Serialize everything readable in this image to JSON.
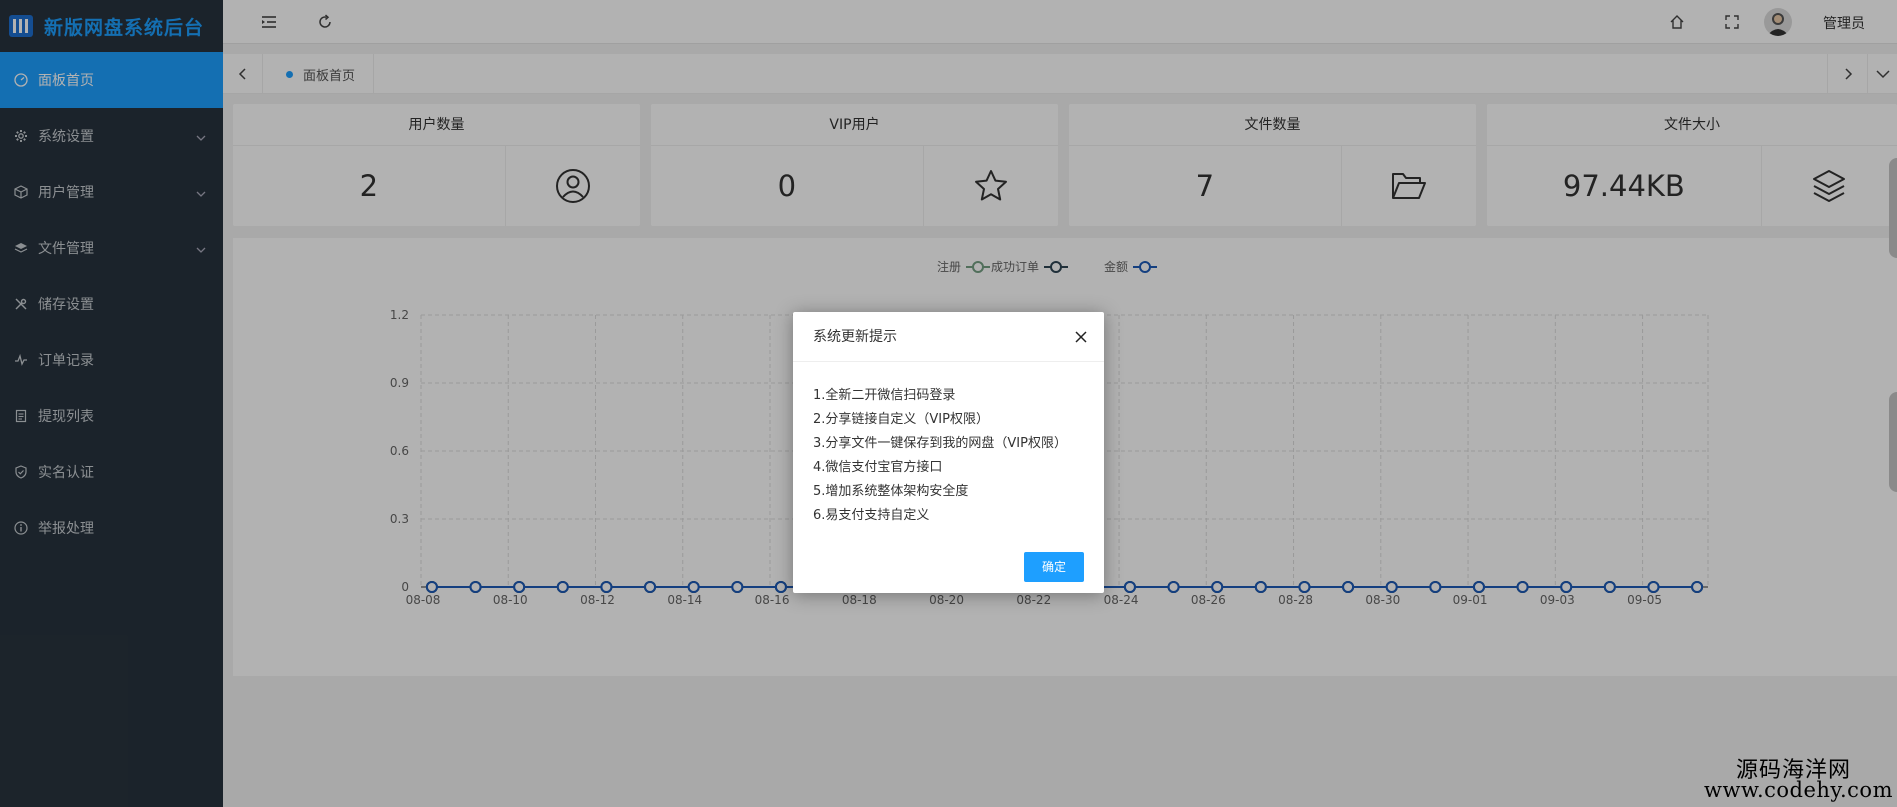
{
  "app": {
    "logo_text": "新版网盘系统后台"
  },
  "sidebar": {
    "items": [
      {
        "label": "面板首页",
        "icon": "dashboard-icon",
        "active": true,
        "has_arrow": false
      },
      {
        "label": "系统设置",
        "icon": "gear-icon",
        "active": false,
        "has_arrow": true
      },
      {
        "label": "用户管理",
        "icon": "cube-icon",
        "active": false,
        "has_arrow": true
      },
      {
        "label": "文件管理",
        "icon": "layers-icon",
        "active": false,
        "has_arrow": true
      },
      {
        "label": "储存设置",
        "icon": "tools-icon",
        "active": false,
        "has_arrow": false
      },
      {
        "label": "订单记录",
        "icon": "pulse-icon",
        "active": false,
        "has_arrow": false
      },
      {
        "label": "提现列表",
        "icon": "list-icon",
        "active": false,
        "has_arrow": false
      },
      {
        "label": "实名认证",
        "icon": "shield-icon",
        "active": false,
        "has_arrow": false
      },
      {
        "label": "举报处理",
        "icon": "info-icon",
        "active": false,
        "has_arrow": false
      }
    ]
  },
  "header": {
    "user_name": "管理员"
  },
  "tabs": {
    "current": "面板首页"
  },
  "stats": [
    {
      "title": "用户数量",
      "value": "2",
      "icon": "user-circle-icon"
    },
    {
      "title": "VIP用户",
      "value": "0",
      "icon": "star-icon"
    },
    {
      "title": "文件数量",
      "value": "7",
      "icon": "folder-open-icon"
    },
    {
      "title": "文件大小",
      "value": "97.44KB",
      "icon": "stack-icon"
    }
  ],
  "chart_data": {
    "type": "line",
    "legend": [
      "注册",
      "成功订单",
      "金额"
    ],
    "legend_placement": "top-center",
    "x": [
      "08-08",
      "08-09",
      "08-10",
      "08-11",
      "08-12",
      "08-13",
      "08-14",
      "08-15",
      "08-16",
      "08-17",
      "08-18",
      "08-19",
      "08-20",
      "08-21",
      "08-22",
      "08-23",
      "08-24",
      "08-25",
      "08-26",
      "08-27",
      "08-28",
      "08-29",
      "08-30",
      "08-31",
      "09-01",
      "09-02",
      "09-03",
      "09-04",
      "09-05",
      "09-06"
    ],
    "x_tick_labels": [
      "08-08",
      "08-10",
      "08-12",
      "08-14",
      "08-16",
      "08-18",
      "08-20",
      "08-22",
      "08-24",
      "08-26",
      "08-28",
      "08-30",
      "09-01",
      "09-03",
      "09-05"
    ],
    "series": [
      {
        "name": "注册",
        "color": "#749f83",
        "values": [
          0,
          0,
          0,
          0,
          0,
          0,
          0,
          0,
          0,
          0,
          0,
          0,
          0,
          0,
          0,
          0,
          0,
          0,
          0,
          0,
          0,
          0,
          0,
          0,
          0,
          0,
          0,
          0,
          0,
          0
        ]
      },
      {
        "name": "成功订单",
        "color": "#2f4554",
        "values": [
          0,
          0,
          0,
          0,
          0,
          0,
          0,
          0,
          0,
          0,
          0,
          0,
          0,
          0,
          0,
          0,
          0,
          0,
          0,
          0,
          0,
          0,
          0,
          0,
          0,
          0,
          0,
          0,
          0,
          0
        ]
      },
      {
        "name": "金额",
        "color": "#1e5bb8",
        "values": [
          0,
          0,
          0,
          0,
          0,
          0,
          0,
          0,
          0,
          0,
          0,
          0,
          0,
          0,
          0,
          0,
          0,
          0,
          0,
          0,
          0,
          0,
          0,
          0,
          0,
          0,
          0,
          0,
          0,
          0
        ]
      }
    ],
    "y_ticks": [
      "0",
      "0.3",
      "0.6",
      "0.9",
      "1.2"
    ],
    "ylim": [
      0,
      1.2
    ],
    "grid": true
  },
  "dialog": {
    "title": "系统更新提示",
    "lines": [
      "1.全新二开微信扫码登录",
      "2.分享链接自定义（VIP权限）",
      "3.分享文件一键保存到我的网盘（VIP权限）",
      "4.微信支付宝官方接口",
      "5.增加系统整体架构安全度",
      "6.易支付支持自定义"
    ],
    "ok_label": "确定"
  },
  "watermark": {
    "line1": "源码海洋网",
    "line2": "www.codehy.com"
  }
}
